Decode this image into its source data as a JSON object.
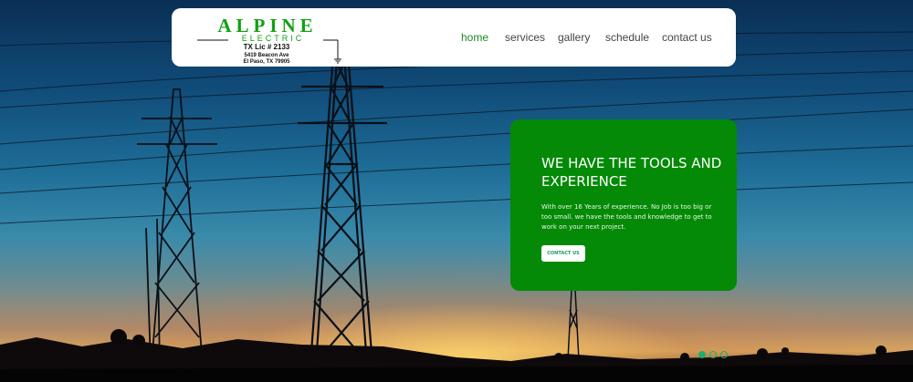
{
  "header": {
    "logo": {
      "title": "ALPINE",
      "subtitle": "ELECTRIC",
      "license": "TX Lic # 2133",
      "address_line1": "5419 Beacon Ave",
      "address_line2": "El Paso, TX 79905"
    },
    "nav": [
      {
        "label": "home",
        "active": true
      },
      {
        "label": "services",
        "active": false
      },
      {
        "label": "gallery",
        "active": false
      },
      {
        "label": "schedule",
        "active": false
      },
      {
        "label": "contact us",
        "active": false
      }
    ]
  },
  "hero": {
    "background": "power-towers-sunset-photo",
    "promo": {
      "title": "WE HAVE THE TOOLS AND EXPERIENCE",
      "body": "With over 16 Years of experience. No Job is too big or too small. we have the tools and knowledge to get to work on your next project.",
      "button_label": "CONTACT US"
    },
    "slider_dots": 3,
    "active_dot": 0
  },
  "colors": {
    "accent_green": "#048a06",
    "nav_active": "#1d8a1d",
    "dot": "#1bb06f"
  }
}
